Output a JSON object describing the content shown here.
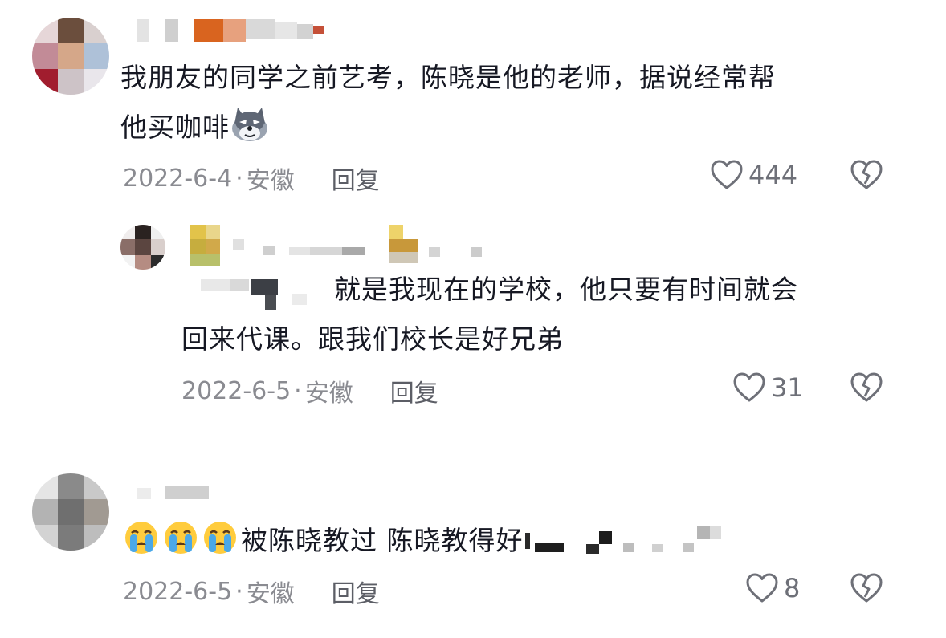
{
  "comments": [
    {
      "text_line1": "我朋友的同学之前艺考，陈晓是他的老师，据说经常帮",
      "text_line2": "他买咖啡",
      "date": "2022-6-4",
      "location": "安徽",
      "reply_label": "回复",
      "likes": "444"
    },
    {
      "text_line1": "就是我现在的学校，他只要有时间就会",
      "text_line2": "回来代课。跟我们校长是好兄弟",
      "date": "2022-6-5",
      "location": "安徽",
      "reply_label": "回复",
      "likes": "31"
    },
    {
      "text_line1": "被陈晓教过 陈晓教得好",
      "date": "2022-6-5",
      "location": "安徽",
      "reply_label": "回复",
      "likes": "8"
    }
  ],
  "icons": {
    "like": "heart-outline-icon",
    "dislike": "broken-heart-icon",
    "wolf_emoji": "wolf-emoji-icon",
    "cry_emoji": "crying-emoji-icon"
  },
  "colors": {
    "text": "#161823",
    "meta": "#8a8b91",
    "icon": "#6e7078"
  }
}
